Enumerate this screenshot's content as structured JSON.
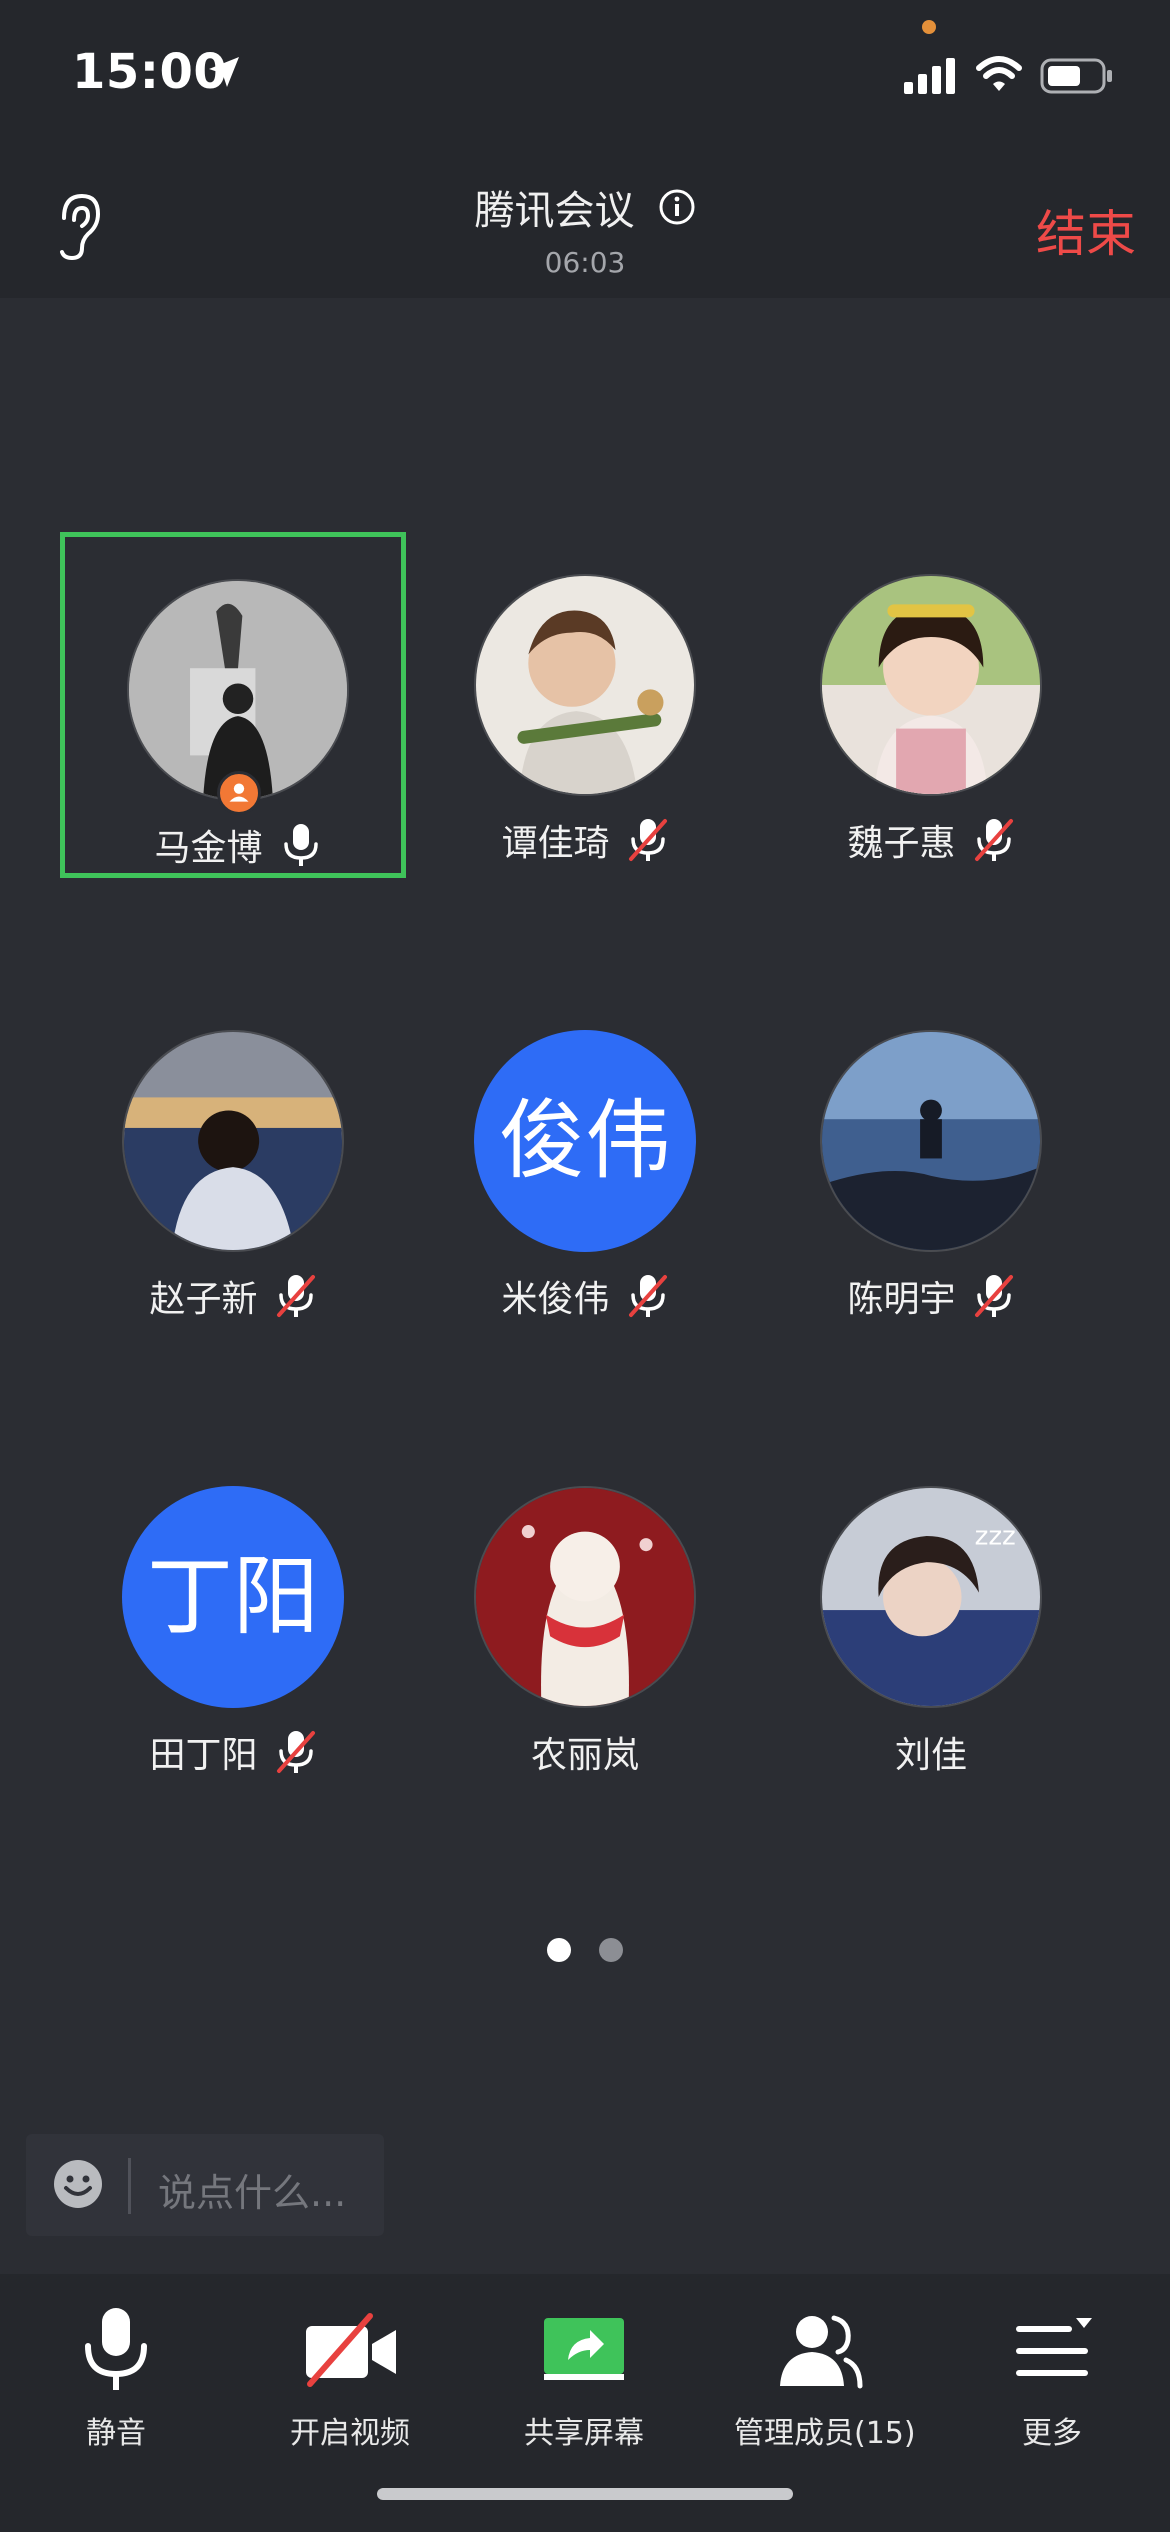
{
  "status_bar": {
    "time": "15:00"
  },
  "header": {
    "title": "腾讯会议",
    "timer": "06:03",
    "end_label": "结束"
  },
  "participants": [
    {
      "name": "马金博",
      "mic": "on",
      "host": true,
      "active": true
    },
    {
      "name": "谭佳琦",
      "mic": "muted"
    },
    {
      "name": "魏子惠",
      "mic": "muted"
    },
    {
      "name": "赵子新",
      "mic": "muted"
    },
    {
      "name": "米俊伟",
      "mic": "muted",
      "initials": "俊伟"
    },
    {
      "name": "陈明宇",
      "mic": "muted"
    },
    {
      "name": "田丁阳",
      "mic": "muted",
      "initials": "丁阳"
    },
    {
      "name": "农丽岚",
      "mic": "none"
    },
    {
      "name": "刘佳",
      "mic": "none"
    }
  ],
  "pagination": {
    "current": 1,
    "total": 2
  },
  "chat": {
    "placeholder": "说点什么..."
  },
  "toolbar": {
    "mute": "静音",
    "video": "开启视频",
    "share": "共享屏幕",
    "members": "管理成员(15)",
    "more": "更多"
  },
  "colors": {
    "background": "#2b2d33",
    "bar": "#25272c",
    "end": "#ee4a48",
    "active_border": "#3fc35a",
    "initials_bg": "#2e6cf6",
    "share_green": "#3fc35a",
    "mute_red": "#e8413f",
    "host_badge": "#f27835"
  }
}
